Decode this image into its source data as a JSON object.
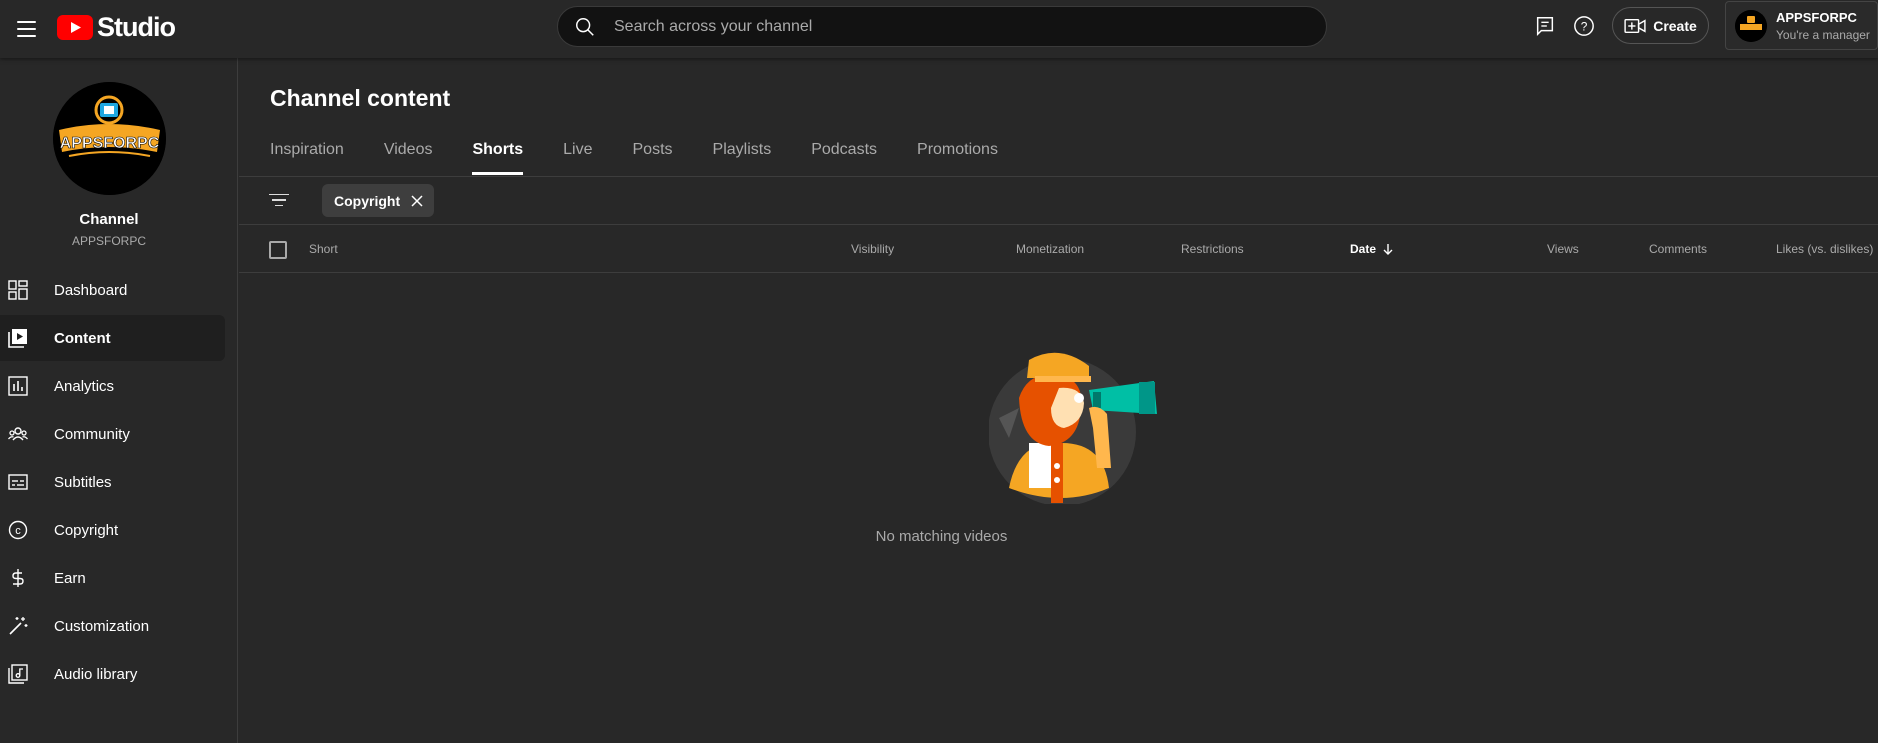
{
  "header": {
    "logo_text": "Studio",
    "search_placeholder": "Search across your channel",
    "create_label": "Create",
    "account_name": "APPSFORPC",
    "account_role": "You're a manager"
  },
  "channel": {
    "title": "Channel",
    "name": "APPSFORPC",
    "avatar_text": "APPSFORPC"
  },
  "sidebar": {
    "items": [
      {
        "label": "Dashboard",
        "icon": "dashboard-icon"
      },
      {
        "label": "Content",
        "icon": "content-icon",
        "active": true
      },
      {
        "label": "Analytics",
        "icon": "analytics-icon"
      },
      {
        "label": "Community",
        "icon": "community-icon"
      },
      {
        "label": "Subtitles",
        "icon": "subtitles-icon"
      },
      {
        "label": "Copyright",
        "icon": "copyright-icon"
      },
      {
        "label": "Earn",
        "icon": "earn-icon"
      },
      {
        "label": "Customization",
        "icon": "customization-icon"
      },
      {
        "label": "Audio library",
        "icon": "audio-library-icon"
      }
    ]
  },
  "main": {
    "title": "Channel content",
    "tabs": [
      "Inspiration",
      "Videos",
      "Shorts",
      "Live",
      "Posts",
      "Playlists",
      "Podcasts",
      "Promotions"
    ],
    "active_tab": "Shorts",
    "filter_chip": "Copyright",
    "columns": {
      "short": "Short",
      "visibility": "Visibility",
      "monetization": "Monetization",
      "restrictions": "Restrictions",
      "date": "Date",
      "views": "Views",
      "comments": "Comments",
      "likes": "Likes (vs. dislikes)"
    },
    "empty_message": "No matching videos"
  },
  "colors": {
    "background": "#282828",
    "brand_red": "#ff0000",
    "surface_dark": "#1f1f1f"
  }
}
